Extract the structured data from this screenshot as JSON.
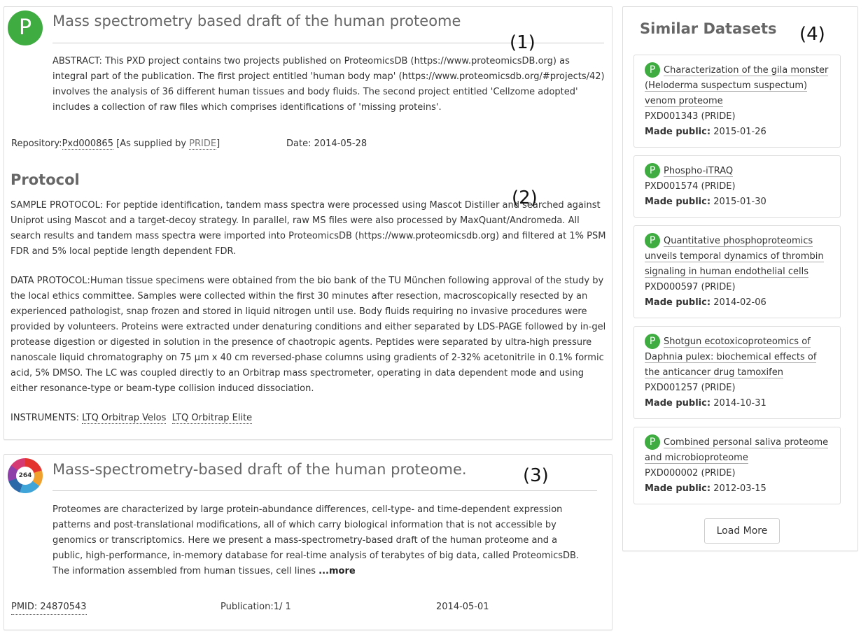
{
  "dataset": {
    "badge": "P",
    "title": "Mass spectrometry based draft of the human proteome",
    "abstract": "ABSTRACT: This PXD project contains two projects published on ProteomicsDB (https://www.proteomicsDB.org) as integral part of the publication. The first project entitled 'human body map' (https://www.proteomicsdb.org/#projects/42) involves the analysis of 36 different human tissues and body fluids. The second project entitled 'Cellzome adopted' includes a collection of raw files which comprises identifications of 'missing proteins'.",
    "repository_label": "Repository:",
    "repository_id": "Pxd000865",
    "supplied_prefix": " [As supplied by ",
    "supplied_by": "PRIDE",
    "supplied_suffix": "]",
    "date": "Date: 2014-05-28"
  },
  "protocol": {
    "heading": "Protocol",
    "sample": "SAMPLE PROTOCOL: For peptide identification, tandem mass spectra were processed using Mascot Distiller and searched against Uniprot using Mascot and a target-decoy strategy. In parallel, raw MS files were also processed by MaxQuant/Andromeda. All search results and tandem mass spectra were imported into ProteomicsDB (https://www.proteomicsdb.org) and filtered at 1% PSM FDR and 5% local peptide length dependent FDR.",
    "data": "DATA PROTOCOL:Human tissue specimens were obtained from the bio bank of the TU München following approval of the study by the local ethics committee. Samples were collected within the first 30 minutes after resection, macroscopically resected by an experienced pathologist, snap frozen and stored in liquid nitrogen until use. Body fluids requiring no invasive procedures were provided by volunteers. Proteins were extracted under denaturing conditions and either separated by LDS-PAGE followed by in-gel protease digestion or digested in solution in the presence of chaotropic agents. Peptides were separated by ultra-high pressure nanoscale liquid chromatography on 75 µm x 40 cm reversed-phase columns using gradients of 2-32% acetonitrile in 0.1% formic acid, 5% DMSO. The LC was coupled directly to an Orbitrap mass spectrometer, operating in data dependent mode and using either resonance-type or beam-type collision induced dissociation.",
    "instruments_label": "INSTRUMENTS: ",
    "instruments": [
      "LTQ Orbitrap Velos",
      "LTQ Orbitrap Elite"
    ]
  },
  "publication": {
    "altmetric_score": "264",
    "title": "Mass-spectrometry-based draft of the human proteome.",
    "abstract": "Proteomes are characterized by large protein-abundance differences, cell-type- and time-dependent expression patterns and post-translational modifications, all of which carry biological information that is not accessible by genomics or transcriptomics. Here we present a mass-spectrometry-based draft of the human proteome and a public, high-performance, in-memory database for real-time analysis of terabytes of big data, called ProteomicsDB. The information assembled from human tissues, cell lines ",
    "more": "...more",
    "pmid": "PMID: 24870543",
    "count": "Publication:1/ 1",
    "date": "2014-05-01"
  },
  "similar": {
    "heading": "Similar Datasets",
    "made_public_label": "Made public:",
    "items": [
      {
        "badge": "P",
        "title": "Characterization of the gila monster (Heloderma suspectum suspectum) venom proteome",
        "id": "PXD001343 (PRIDE)",
        "date": "2015-01-26"
      },
      {
        "badge": "P",
        "title": "Phospho-iTRAQ",
        "id": "PXD001574 (PRIDE)",
        "date": "2015-01-30"
      },
      {
        "badge": "P",
        "title": "Quantitative phosphoproteomics unveils temporal dynamics of thrombin signaling in human endothelial cells",
        "id": "PXD000597 (PRIDE)",
        "date": "2014-02-06"
      },
      {
        "badge": "P",
        "title": "Shotgun ecotoxicoproteomics of Daphnia pulex: biochemical effects of the anticancer drug tamoxifen",
        "id": "PXD001257 (PRIDE)",
        "date": "2014-10-31"
      },
      {
        "badge": "P",
        "title": "Combined personal saliva proteome and microbioproteome",
        "id": "PXD000002 (PRIDE)",
        "date": "2012-03-15"
      }
    ],
    "load_more": "Load More"
  },
  "annotations": [
    "(1)",
    "(2)",
    "(3)",
    "(4)"
  ]
}
